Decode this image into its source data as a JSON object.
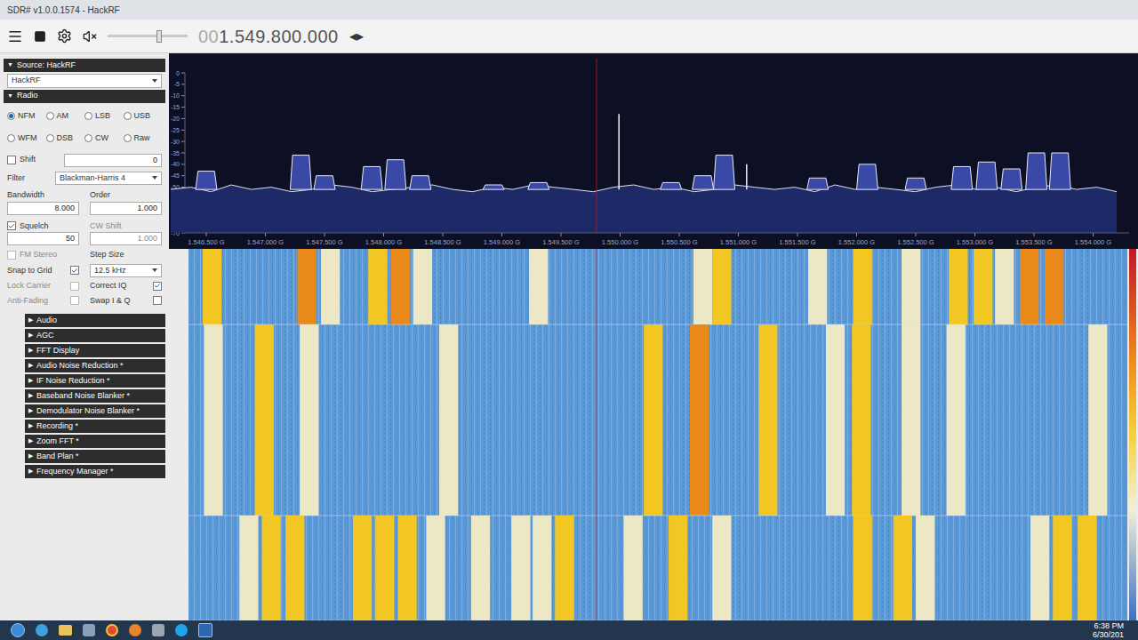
{
  "window": {
    "title": "SDR# v1.0.0.1574 - HackRF"
  },
  "toolbar": {
    "volume_level": 0.65,
    "frequency": {
      "leading": "00",
      "value": "1.549.800.000"
    },
    "frequency_arrows": "◂▸"
  },
  "glyphs": {
    "expanded": "▼",
    "collapsed": "▶"
  },
  "source": {
    "header": "Source: HackRF",
    "expanded": true,
    "device": "HackRF"
  },
  "radio": {
    "header": "Radio",
    "expanded": true,
    "modes": [
      {
        "label": "NFM",
        "selected": true
      },
      {
        "label": "AM",
        "selected": false
      },
      {
        "label": "LSB",
        "selected": false
      },
      {
        "label": "USB",
        "selected": false
      },
      {
        "label": "WFM",
        "selected": false
      },
      {
        "label": "DSB",
        "selected": false
      },
      {
        "label": "CW",
        "selected": false
      },
      {
        "label": "Raw",
        "selected": false
      }
    ],
    "shift": {
      "label": "Shift",
      "checked": false,
      "value": "0"
    },
    "filter": {
      "label": "Filter",
      "value": "Blackman-Harris 4"
    },
    "bandwidth": {
      "label": "Bandwidth",
      "value": "8.000"
    },
    "order": {
      "label": "Order",
      "value": "1.000"
    },
    "squelch": {
      "label": "Squelch",
      "checked": true,
      "value": "50"
    },
    "cw_shift": {
      "label": "CW Shift",
      "value": "1.000",
      "disabled": true
    },
    "fm_stereo": {
      "label": "FM Stereo",
      "checked": false,
      "disabled": true
    },
    "step_size": {
      "label": "Step Size",
      "value": "12.5 kHz"
    },
    "checks": [
      {
        "label": "Snap to Grid",
        "checked": true,
        "disabled": false
      },
      {
        "label": "Lock Carrier",
        "checked": false,
        "disabled": true
      },
      {
        "label": "Correct IQ",
        "checked": true,
        "disabled": false
      },
      {
        "label": "Anti-Fading",
        "checked": false,
        "disabled": true
      },
      {
        "label": "Swap I & Q",
        "checked": false,
        "disabled": false
      }
    ]
  },
  "sections": [
    {
      "label": "Audio",
      "expanded": false
    },
    {
      "label": "AGC",
      "expanded": false
    },
    {
      "label": "FFT Display",
      "expanded": false
    },
    {
      "label": "Audio Noise Reduction *",
      "expanded": false
    },
    {
      "label": "IF Noise Reduction *",
      "expanded": false
    },
    {
      "label": "Baseband Noise Blanker *",
      "expanded": false
    },
    {
      "label": "Demodulator Noise Blanker *",
      "expanded": false
    },
    {
      "label": "Recording *",
      "expanded": false
    },
    {
      "label": "Zoom FFT *",
      "expanded": false
    },
    {
      "label": "Band Plan *",
      "expanded": false
    },
    {
      "label": "Frequency Manager *",
      "expanded": false
    }
  ],
  "spectrum": {
    "center_ghz": 1.5498,
    "y_ticks": [
      "0",
      "-5",
      "-10",
      "-15",
      "-20",
      "-25",
      "-30",
      "-35",
      "-40",
      "-45",
      "-50",
      "-55",
      "-60",
      "-65",
      "-70"
    ],
    "x_ticks": [
      {
        "label": "1.546.500 G",
        "ghz": 1.5465
      },
      {
        "label": "1.547.000 G",
        "ghz": 1.547
      },
      {
        "label": "1.547.500 G",
        "ghz": 1.5475
      },
      {
        "label": "1.548.000 G",
        "ghz": 1.548
      },
      {
        "label": "1.548.500 G",
        "ghz": 1.5485
      },
      {
        "label": "1.549.000 G",
        "ghz": 1.549
      },
      {
        "label": "1.549.500 G",
        "ghz": 1.5495
      },
      {
        "label": "1.550.000 G",
        "ghz": 1.55
      },
      {
        "label": "1.550.500 G",
        "ghz": 1.5505
      },
      {
        "label": "1.551.000 G",
        "ghz": 1.551
      },
      {
        "label": "1.551.500 G",
        "ghz": 1.5515
      },
      {
        "label": "1.552.000 G",
        "ghz": 1.552
      },
      {
        "label": "1.552.500 G",
        "ghz": 1.5525
      },
      {
        "label": "1.553.000 G",
        "ghz": 1.553
      },
      {
        "label": "1.553.500 G",
        "ghz": 1.5535
      },
      {
        "label": "1.554.000 G",
        "ghz": 1.554
      }
    ],
    "floor_start_ghz": 1.5462,
    "floor_end_ghz": 1.5542,
    "noise_floor_db": [
      -51,
      -50,
      -52,
      -49,
      -51,
      -50,
      -52,
      -51,
      -49,
      -50,
      -52,
      -51,
      -50,
      -49,
      -51,
      -52,
      -50,
      -51,
      -49,
      -50,
      -51,
      -52,
      -50,
      -49,
      -51,
      -50,
      -52,
      -51,
      -49,
      -50,
      -51,
      -50,
      -52,
      -49,
      -51,
      -50,
      -51,
      -52,
      -50,
      -49,
      -51,
      -50,
      -52,
      -50,
      -49,
      -51,
      -50,
      -52
    ],
    "channels": [
      {
        "ghz": 1.5465,
        "db": -43
      },
      {
        "ghz": 1.5473,
        "db": -36
      },
      {
        "ghz": 1.5475,
        "db": -45
      },
      {
        "ghz": 1.5479,
        "db": -41
      },
      {
        "ghz": 1.5481,
        "db": -38
      },
      {
        "ghz": 1.54831,
        "db": -45
      },
      {
        "ghz": 1.54893,
        "db": -49
      },
      {
        "ghz": 1.54931,
        "db": -48
      },
      {
        "ghz": 1.55043,
        "db": -48
      },
      {
        "ghz": 1.5507,
        "db": -45
      },
      {
        "ghz": 1.55088,
        "db": -36
      },
      {
        "ghz": 1.55167,
        "db": -46
      },
      {
        "ghz": 1.55209,
        "db": -40
      },
      {
        "ghz": 1.5525,
        "db": -46
      },
      {
        "ghz": 1.55289,
        "db": -41
      },
      {
        "ghz": 1.5531,
        "db": -39
      },
      {
        "ghz": 1.55331,
        "db": -42
      },
      {
        "ghz": 1.55352,
        "db": -35
      },
      {
        "ghz": 1.55372,
        "db": -35
      }
    ],
    "spikes": [
      {
        "ghz": 1.54999,
        "db": -18
      },
      {
        "ghz": 1.55107,
        "db": -40
      }
    ]
  },
  "waterfall": {
    "bands": [
      {
        "bars": [
          {
            "ghz": 1.54655,
            "level": 0.7
          },
          {
            "ghz": 1.54735,
            "level": 0.9
          },
          {
            "ghz": 1.54755,
            "level": 0.45
          },
          {
            "ghz": 1.54795,
            "level": 0.7
          },
          {
            "ghz": 1.54814,
            "level": 0.9
          },
          {
            "ghz": 1.54833,
            "level": 0.45
          },
          {
            "ghz": 1.54931,
            "level": 0.45
          },
          {
            "ghz": 1.5507,
            "level": 0.45
          },
          {
            "ghz": 1.55086,
            "level": 0.7
          },
          {
            "ghz": 1.55167,
            "level": 0.45
          },
          {
            "ghz": 1.55205,
            "level": 0.7
          },
          {
            "ghz": 1.55246,
            "level": 0.45
          },
          {
            "ghz": 1.55286,
            "level": 0.7
          },
          {
            "ghz": 1.55307,
            "level": 0.7
          },
          {
            "ghz": 1.55325,
            "level": 0.45
          },
          {
            "ghz": 1.55346,
            "level": 0.9
          },
          {
            "ghz": 1.55367,
            "level": 0.9
          }
        ]
      },
      {
        "bars": [
          {
            "ghz": 1.54656,
            "level": 0.45
          },
          {
            "ghz": 1.54699,
            "level": 0.7
          },
          {
            "ghz": 1.54737,
            "level": 0.45
          },
          {
            "ghz": 1.54855,
            "level": 0.45
          },
          {
            "ghz": 1.55028,
            "level": 0.7
          },
          {
            "ghz": 1.55067,
            "level": 0.9
          },
          {
            "ghz": 1.55125,
            "level": 0.7
          },
          {
            "ghz": 1.55182,
            "level": 0.45
          },
          {
            "ghz": 1.55204,
            "level": 0.7
          },
          {
            "ghz": 1.55246,
            "level": 0.45
          },
          {
            "ghz": 1.55284,
            "level": 0.45
          },
          {
            "ghz": 1.55404,
            "level": 0.45
          }
        ]
      },
      {
        "bars": [
          {
            "ghz": 1.54686,
            "level": 0.45
          },
          {
            "ghz": 1.54705,
            "level": 0.7
          },
          {
            "ghz": 1.54725,
            "level": 0.7
          },
          {
            "ghz": 1.54782,
            "level": 0.7
          },
          {
            "ghz": 1.54801,
            "level": 0.7
          },
          {
            "ghz": 1.5482,
            "level": 0.7
          },
          {
            "ghz": 1.54844,
            "level": 0.45
          },
          {
            "ghz": 1.54882,
            "level": 0.45
          },
          {
            "ghz": 1.54916,
            "level": 0.45
          },
          {
            "ghz": 1.54934,
            "level": 0.45
          },
          {
            "ghz": 1.54953,
            "level": 0.7
          },
          {
            "ghz": 1.55011,
            "level": 0.45
          },
          {
            "ghz": 1.55049,
            "level": 0.7
          },
          {
            "ghz": 1.55086,
            "level": 0.45
          },
          {
            "ghz": 1.55205,
            "level": 0.7
          },
          {
            "ghz": 1.55239,
            "level": 0.7
          },
          {
            "ghz": 1.55258,
            "level": 0.45
          },
          {
            "ghz": 1.55355,
            "level": 0.45
          },
          {
            "ghz": 1.55374,
            "level": 0.7
          },
          {
            "ghz": 1.55395,
            "level": 0.7
          }
        ]
      }
    ]
  },
  "taskbar": {
    "time": "6:38 PM",
    "date": "6/30/201"
  }
}
